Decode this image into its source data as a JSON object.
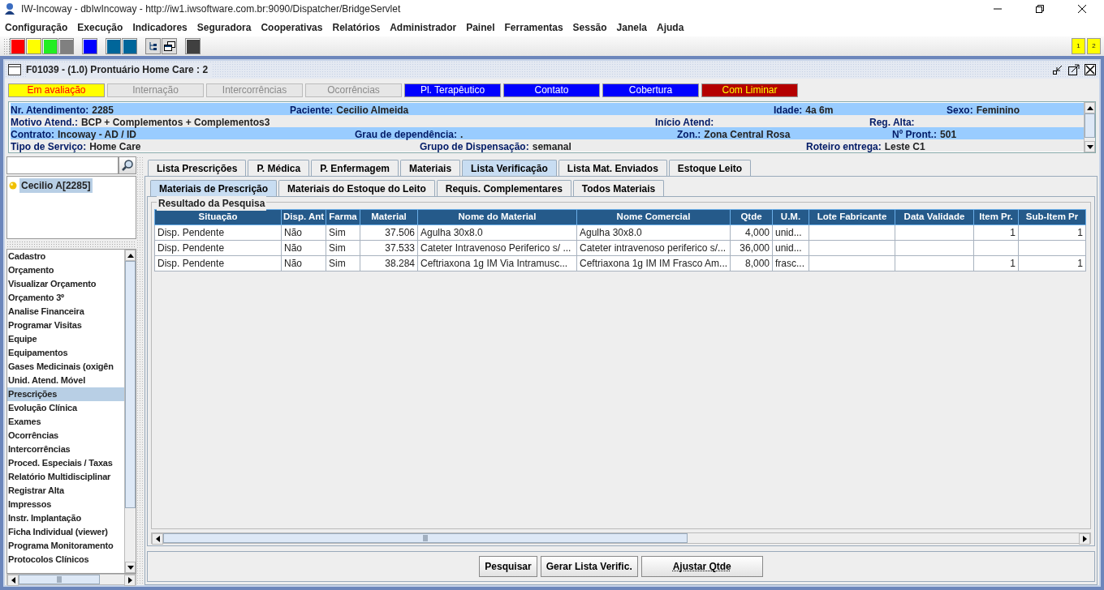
{
  "window": {
    "title": "IW-Incoway - dbIwIncoway - http://iw1.iwsoftware.com.br:9090/Dispatcher/BridgeServlet"
  },
  "menu": [
    "Configuração",
    "Execução",
    "Indicadores",
    "Seguradora",
    "Cooperativas",
    "Relatórios",
    "Administrador",
    "Painel",
    "Ferramentas",
    "Sessão",
    "Janela",
    "Ajuda"
  ],
  "toolbar": [
    [
      {
        "kind": "swatch",
        "color": "#ff0000"
      },
      {
        "kind": "swatch",
        "color": "#ffff00"
      },
      {
        "kind": "swatch",
        "color": "#22ee22"
      },
      {
        "kind": "swatch",
        "color": "#808080"
      }
    ],
    [
      {
        "kind": "swatch",
        "color": "#0000ff"
      }
    ],
    [
      {
        "kind": "swatch",
        "color": "#00669a"
      },
      {
        "kind": "swatch",
        "color": "#00669a"
      }
    ],
    [
      {
        "kind": "tree"
      },
      {
        "kind": "windows"
      }
    ],
    [
      {
        "kind": "swatch",
        "color": "#404040"
      }
    ]
  ],
  "workspaces": [
    "1",
    "2"
  ],
  "inner_window": {
    "title": "F01039 - (1.0) Prontuário Home Care : 2"
  },
  "status_buttons": [
    {
      "label": "Em avaliação",
      "kind": "warning",
      "disabled": false
    },
    {
      "label": "Internação",
      "kind": "plain",
      "disabled": true
    },
    {
      "label": "Intercorrências",
      "kind": "plain",
      "disabled": true
    },
    {
      "label": "Ocorrências",
      "kind": "plain",
      "disabled": true
    },
    {
      "label": "Pl. Terapêutico",
      "kind": "info",
      "disabled": false
    },
    {
      "label": "Contato",
      "kind": "info",
      "disabled": false
    },
    {
      "label": "Cobertura",
      "kind": "info",
      "disabled": false
    },
    {
      "label": "Com Liminar",
      "kind": "alert",
      "disabled": false
    }
  ],
  "info_rows": [
    {
      "highlighted": true,
      "fields": [
        {
          "label": "Nr. Atendimento:",
          "value": "2285"
        },
        {
          "label": "Paciente:",
          "value": "Cecilio Almeida"
        },
        {
          "label": "Idade:",
          "value": "4a 6m"
        },
        {
          "label": "Sexo:",
          "value": "Feminino"
        }
      ]
    },
    {
      "highlighted": false,
      "fields": [
        {
          "label": "Motivo Atend.:",
          "value": "BCP + Complementos + Complementos3"
        },
        {
          "label": "Início Atend:"
        },
        {
          "label": "Reg. Alta:"
        }
      ]
    },
    {
      "highlighted": true,
      "fields": [
        {
          "label": "Contrato:",
          "value": "Incoway - AD / ID"
        },
        {
          "label": "Grau de dependência:",
          "value": "."
        },
        {
          "label": "Zon.:",
          "value": "Zona Central Rosa"
        },
        {
          "label": "Nº Pront.:",
          "value": "501"
        }
      ]
    },
    {
      "highlighted": false,
      "fields": [
        {
          "label": "Tipo de Serviço:",
          "value": "Home Care"
        },
        {
          "label": "Grupo de Dispensação:",
          "value": "semanal"
        },
        {
          "label": "Roteiro entrega:",
          "value": "Leste C1"
        }
      ]
    }
  ],
  "patients": [
    {
      "label": "Cecilio A[2285]",
      "selected": true
    }
  ],
  "sidebar": {
    "items": [
      {
        "label": "Cadastro",
        "selected": false
      },
      {
        "label": "Orçamento",
        "selected": false
      },
      {
        "label": "Visualizar Orçamento",
        "selected": false
      },
      {
        "label": "Orçamento 3º",
        "selected": false
      },
      {
        "label": "Analise Financeira",
        "selected": false
      },
      {
        "label": "Programar Visitas",
        "selected": false
      },
      {
        "label": "Equipe",
        "selected": false
      },
      {
        "label": "Equipamentos",
        "selected": false
      },
      {
        "label": "Gases Medicinais (oxigên",
        "selected": false
      },
      {
        "label": "Unid. Atend. Móvel",
        "selected": false
      },
      {
        "label": "Prescrições",
        "selected": true
      },
      {
        "label": "Evolução Clínica",
        "selected": false
      },
      {
        "label": "Exames",
        "selected": false
      },
      {
        "label": "Ocorrências",
        "selected": false
      },
      {
        "label": "Intercorrências",
        "selected": false
      },
      {
        "label": "Proced. Especiais / Taxas",
        "selected": false
      },
      {
        "label": "Relatório Multidisciplinar",
        "selected": false
      },
      {
        "label": "Registrar Alta",
        "selected": false
      },
      {
        "label": "Impressos",
        "selected": false
      },
      {
        "label": "Instr. Implantação",
        "selected": false
      },
      {
        "label": "Ficha Individual (viewer)",
        "selected": false
      },
      {
        "label": "Programa Monitoramento",
        "selected": false
      },
      {
        "label": "Protocolos Clínicos",
        "selected": false
      }
    ]
  },
  "tabs": [
    {
      "label": "Lista Prescrições",
      "selected": false
    },
    {
      "label": "P. Médica",
      "selected": false
    },
    {
      "label": "P. Enfermagem",
      "selected": false
    },
    {
      "label": "Materiais",
      "selected": false
    },
    {
      "label": "Lista Verificação",
      "selected": true
    },
    {
      "label": "Lista Mat. Enviados",
      "selected": false
    },
    {
      "label": "Estoque Leito",
      "selected": false
    }
  ],
  "subtabs": [
    {
      "label": "Materiais de Prescrição",
      "selected": true
    },
    {
      "label": "Materiais do Estoque do Leito",
      "selected": false
    },
    {
      "label": "Requis. Complementares",
      "selected": false
    },
    {
      "label": "Todos Materiais",
      "selected": false
    }
  ],
  "group_title": "Resultado da Pesquisa",
  "table": {
    "columns": [
      "Situação",
      "Disp. Ant",
      "Farma",
      "Material",
      "Nome do Material",
      "Nome Comercial",
      "Qtde",
      "U.M.",
      "Lote Fabricante",
      "Data Validade",
      "Item Pr.",
      "Sub-Item Pr"
    ],
    "rows": [
      [
        "Disp. Pendente",
        "Não",
        "Sim",
        "37.506",
        "Agulha 30x8.0",
        "Agulha 30x8.0",
        "4,000",
        "unid...",
        null,
        null,
        "1",
        "1"
      ],
      [
        "Disp. Pendente",
        "Não",
        "Sim",
        "37.533",
        "Cateter Intravenoso Periferico s/ ...",
        "Cateter intravenoso periferico s/...",
        "36,000",
        "unid...",
        null,
        null,
        null,
        null
      ],
      [
        "Disp. Pendente",
        "Não",
        "Sim",
        "38.284",
        "Ceftriaxona   1g IM  Via Intramusc...",
        "Ceftriaxona 1g IM IM Frasco Am...",
        "8,000",
        "frasc...",
        null,
        null,
        "1",
        "1"
      ]
    ]
  },
  "buttons": [
    {
      "label": "Pesquisar",
      "focused": false
    },
    {
      "label": "Gerar Lista Verific.",
      "focused": false
    },
    {
      "label": "Ajustar Qtde",
      "focused": true
    }
  ]
}
